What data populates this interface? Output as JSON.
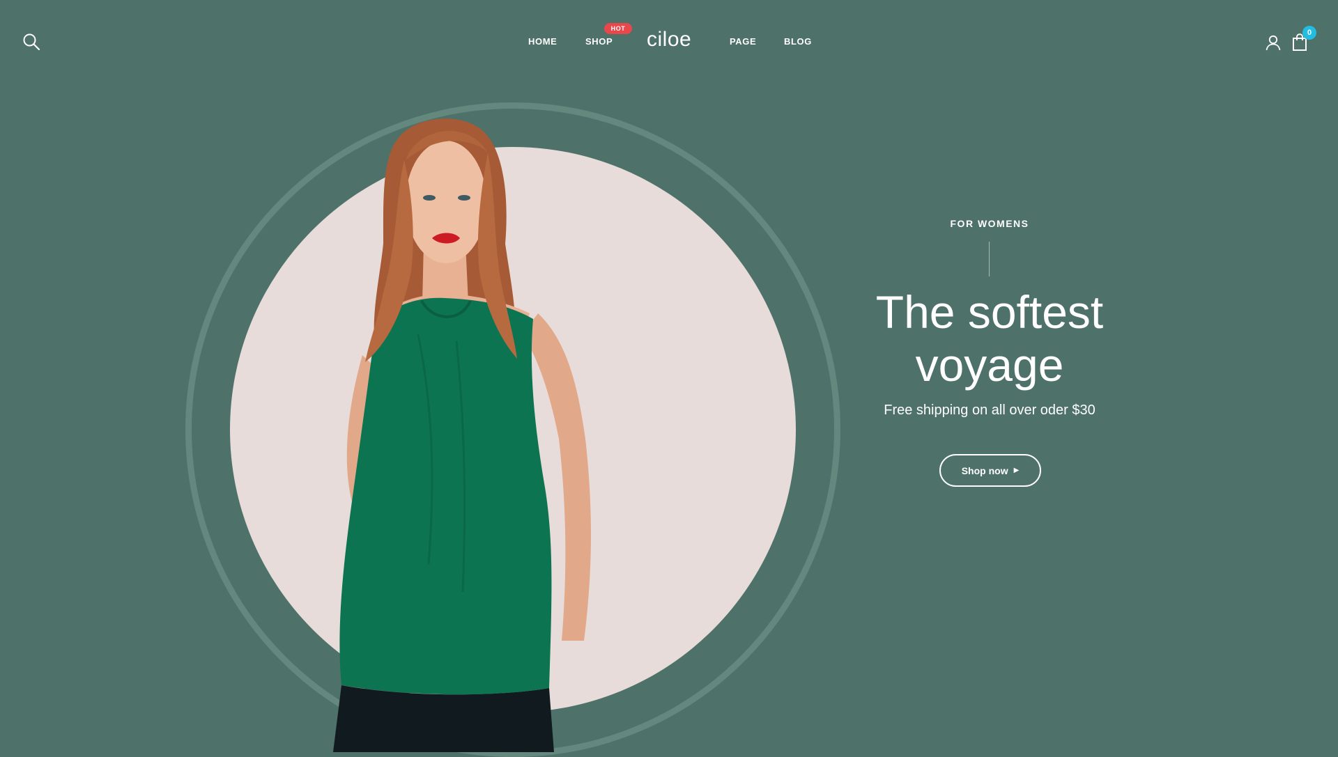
{
  "header": {
    "logo": "ciloe",
    "nav": [
      {
        "label": "HOME"
      },
      {
        "label": "SHOP",
        "badge": "HOT"
      },
      {
        "label": "PAGE"
      },
      {
        "label": "BLOG"
      }
    ],
    "cart_count": "0",
    "icons": {
      "search": "search-icon",
      "account": "user-icon",
      "cart": "shopping-bag-icon"
    }
  },
  "hero": {
    "eyebrow": "FOR WOMENS",
    "headline_line1": "The softest",
    "headline_line2": "voyage",
    "subline": "Free shipping on all over oder $30",
    "cta_label": "Shop now",
    "cta_icon": "caret-right-icon"
  },
  "colors": {
    "background": "#4e7269",
    "disc": "#e7dcda",
    "ring": "#64877e",
    "hot_badge": "#e8474c",
    "cart_badge": "#22bde0",
    "top_green": "#0c7451"
  }
}
